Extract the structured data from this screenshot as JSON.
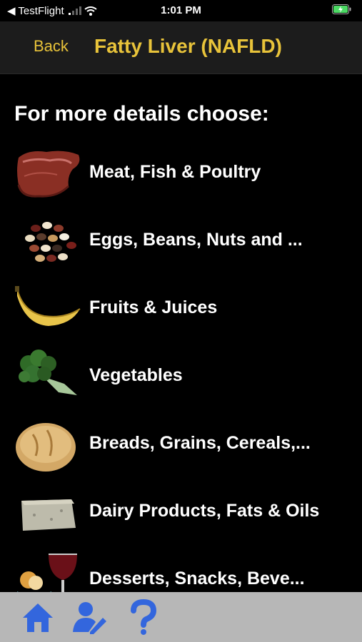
{
  "status_bar": {
    "carrier": "◀ TestFlight",
    "time": "1:01 PM",
    "icon": "battery-charging-icon"
  },
  "nav": {
    "back_label": "Back",
    "title": "Fatty Liver (NAFLD)"
  },
  "prompt": "For more details choose:",
  "items": [
    {
      "label": "Meat, Fish & Poultry",
      "icon": "meat-icon"
    },
    {
      "label": "Eggs, Beans, Nuts and ...",
      "icon": "beans-icon"
    },
    {
      "label": "Fruits & Juices",
      "icon": "banana-icon"
    },
    {
      "label": "Vegetables",
      "icon": "broccoli-icon"
    },
    {
      "label": "Breads, Grains, Cereals,...",
      "icon": "bread-icon"
    },
    {
      "label": "Dairy Products, Fats & Oils",
      "icon": "cheese-icon"
    },
    {
      "label": "Desserts, Snacks, Beve...",
      "icon": "dessert-wine-icon"
    }
  ],
  "tab_bar": {
    "icons": [
      "home-icon",
      "user-edit-icon",
      "help-icon"
    ],
    "accent": "#3366dd"
  },
  "colors": {
    "title": "#e8c33a",
    "background": "#000000",
    "tab_bar": "#b7b7b7"
  }
}
